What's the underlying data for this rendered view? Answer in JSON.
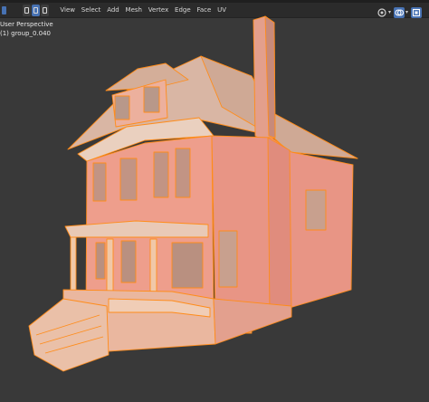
{
  "header": {
    "menu": [
      "View",
      "Select",
      "Add",
      "Mesh",
      "Vertex",
      "Edge",
      "Face",
      "UV"
    ]
  },
  "viewport": {
    "perspective_label": "User Perspective",
    "object_label": "(1) group_0.040"
  },
  "colors": {
    "background": "#393939",
    "header": "#2b2b2b",
    "accent": "#4772b3",
    "wall": "#e8a08f",
    "trim": "#d89a7a",
    "roof": "#d6b7a6",
    "selection": "#ff8c1a"
  },
  "icons": [
    "mode-icon",
    "viewport-gizmo-icon",
    "overlay-icon",
    "xray-icon"
  ]
}
